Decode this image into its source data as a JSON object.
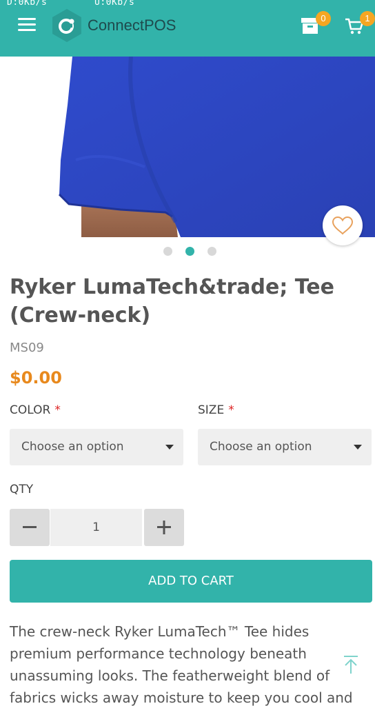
{
  "status_bar": {
    "download": "D:0Kb/s",
    "upload": "U:0Kb/s"
  },
  "header": {
    "brand": "ConnectPOS",
    "compare_count": "0",
    "cart_count": "1"
  },
  "product": {
    "title": "Ryker LumaTech&trade; Tee (Crew-neck)",
    "sku": "MS09",
    "price": "$0.00",
    "gallery": {
      "image_count": 3,
      "active_index": 1
    }
  },
  "options": {
    "color": {
      "label": "COLOR",
      "required_mark": "*",
      "placeholder": "Choose an option"
    },
    "size": {
      "label": "SIZE",
      "required_mark": "*",
      "placeholder": "Choose an option"
    }
  },
  "quantity": {
    "label": "QTY",
    "value": "1"
  },
  "add_to_cart": {
    "label": "ADD TO CART"
  },
  "description": "The crew-neck Ryker LumaTech™ Tee hides premium performance technology beneath unassuming looks. The featherweight blend of fabrics wicks away moisture to keep you cool and dry in every phase of",
  "colors": {
    "accent": "#32b3aa",
    "price": "#e8891d",
    "badge": "#f5a623",
    "required": "#d22222",
    "shirt": "#2f48c4"
  }
}
